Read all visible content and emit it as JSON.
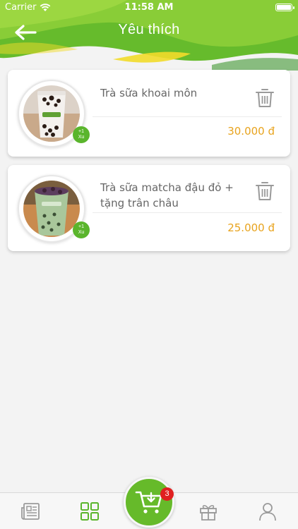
{
  "status_bar": {
    "carrier": "Carrier",
    "time": "11:58 AM"
  },
  "header": {
    "title": "Yêu thích",
    "back_icon": "arrow-left-icon",
    "colors": {
      "primary": "#5ab52c",
      "light": "#8fd03a",
      "accent_wave": "#f2dc2a"
    }
  },
  "favorites": [
    {
      "name": "Trà sữa khoai môn",
      "price": "30.000 đ",
      "badge_line1": "+1",
      "badge_line2": "Xu",
      "delete_icon": "trash-icon"
    },
    {
      "name": "Trà sữa matcha đậu đỏ + tặng trân châu",
      "price": "25.000 đ",
      "badge_line1": "+1",
      "badge_line2": "Xu",
      "delete_icon": "trash-icon"
    }
  ],
  "bottom_nav": {
    "items": [
      {
        "icon": "newspaper-icon",
        "active": false
      },
      {
        "icon": "grid-icon",
        "active": true
      },
      {
        "icon": "cart-icon",
        "active": false
      },
      {
        "icon": "gift-icon",
        "active": false
      },
      {
        "icon": "user-icon",
        "active": false
      }
    ],
    "cart_count": "3",
    "colors": {
      "active": "#5ab52c",
      "inactive": "#9a9a9a",
      "badge": "#e02020"
    }
  }
}
